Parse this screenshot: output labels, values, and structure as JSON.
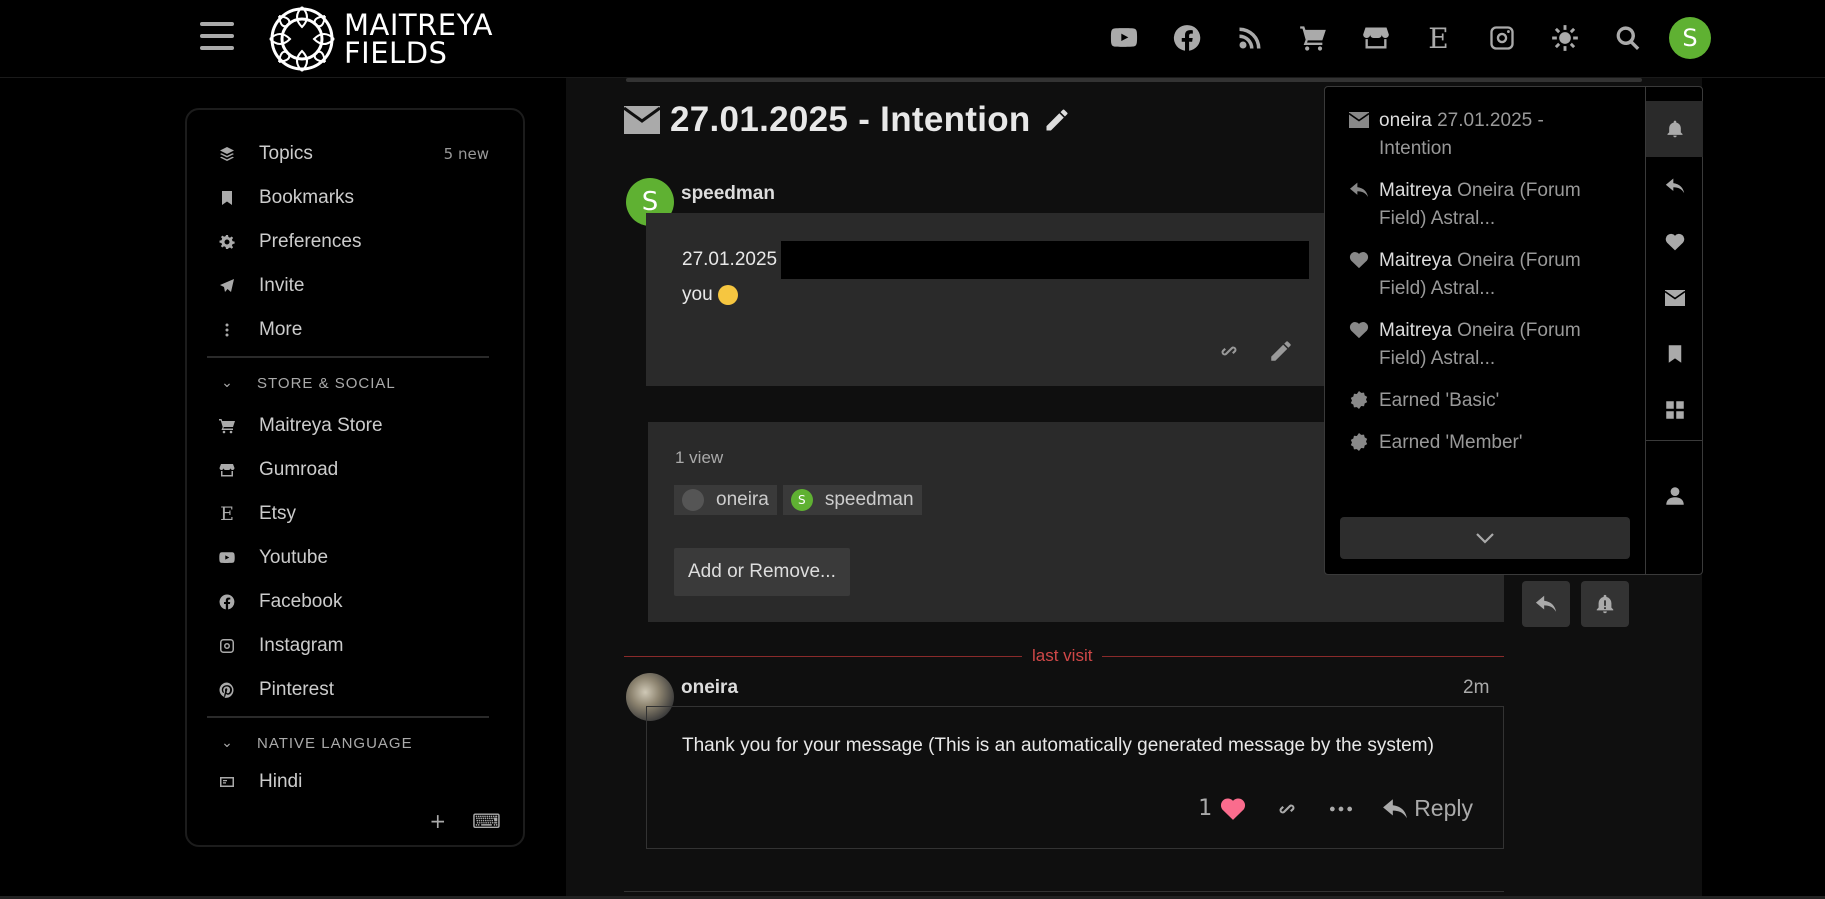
{
  "header": {
    "logo_line1": "MAITREYA",
    "logo_line2": "FIELDS",
    "icons": [
      "youtube-icon",
      "facebook-icon",
      "blog-icon",
      "cart-icon",
      "store-icon",
      "etsy-icon",
      "instagram-icon",
      "theme-toggle-icon",
      "search-icon"
    ],
    "etsy_letter": "E",
    "avatar_letter": "S",
    "avatar_color": "#5fb132"
  },
  "sidebar": {
    "items": [
      {
        "label": "Topics",
        "badge": "5 new"
      },
      {
        "label": "Bookmarks"
      },
      {
        "label": "Preferences"
      },
      {
        "label": "Invite"
      },
      {
        "label": "More"
      }
    ],
    "store_section": "STORE & SOCIAL",
    "store_items": [
      {
        "label": "Maitreya Store"
      },
      {
        "label": "Gumroad"
      },
      {
        "label": "Etsy",
        "icon_letter": "E"
      },
      {
        "label": "Youtube"
      },
      {
        "label": "Facebook"
      },
      {
        "label": "Instagram"
      },
      {
        "label": "Pinterest"
      }
    ],
    "language_section": "NATIVE LANGUAGE",
    "language_items": [
      {
        "label": "Hindi"
      }
    ],
    "footer_add": "+",
    "footer_keyboard": "⌨"
  },
  "topic": {
    "title": "27.01.2025 - Intention"
  },
  "post1": {
    "user": "speedman",
    "avatar_letter": "S",
    "date_text": "27.01.2025",
    "line2": "you"
  },
  "message_participants": {
    "views": "1 view",
    "users": [
      {
        "name": "oneira"
      },
      {
        "name": "speedman",
        "letter": "S"
      }
    ],
    "add_remove": "Add or Remove..."
  },
  "last_visit": "last visit",
  "post2": {
    "user": "oneira",
    "time": "2m",
    "text": "Thank you for your message (This is an automatically generated message by the system)",
    "likes": "1",
    "reply": "Reply"
  },
  "notifications": {
    "items": [
      {
        "icon": "envelope-icon",
        "who": "oneira",
        "text": "27.01.2025 - Intention"
      },
      {
        "icon": "reply-icon",
        "who": "Maitreya",
        "text": "Oneira (Forum Field) Astral..."
      },
      {
        "icon": "heart-icon",
        "who": "Maitreya",
        "text": "Oneira (Forum Field) Astral..."
      },
      {
        "icon": "heart-icon",
        "who": "Maitreya",
        "text": "Oneira (Forum Field) Astral..."
      },
      {
        "icon": "badge-icon",
        "who": "",
        "text": "Earned 'Basic'"
      },
      {
        "icon": "badge-icon",
        "who": "",
        "text": "Earned 'Member'"
      }
    ],
    "tabs": [
      "bell-icon",
      "reply-icon",
      "heart-icon",
      "envelope-icon",
      "bookmark-icon",
      "grid-icon",
      "user-icon"
    ]
  },
  "colors": {
    "accent_green": "#5fb132",
    "like_pink": "#fa6c8d",
    "last_visit_red": "#d04848"
  }
}
